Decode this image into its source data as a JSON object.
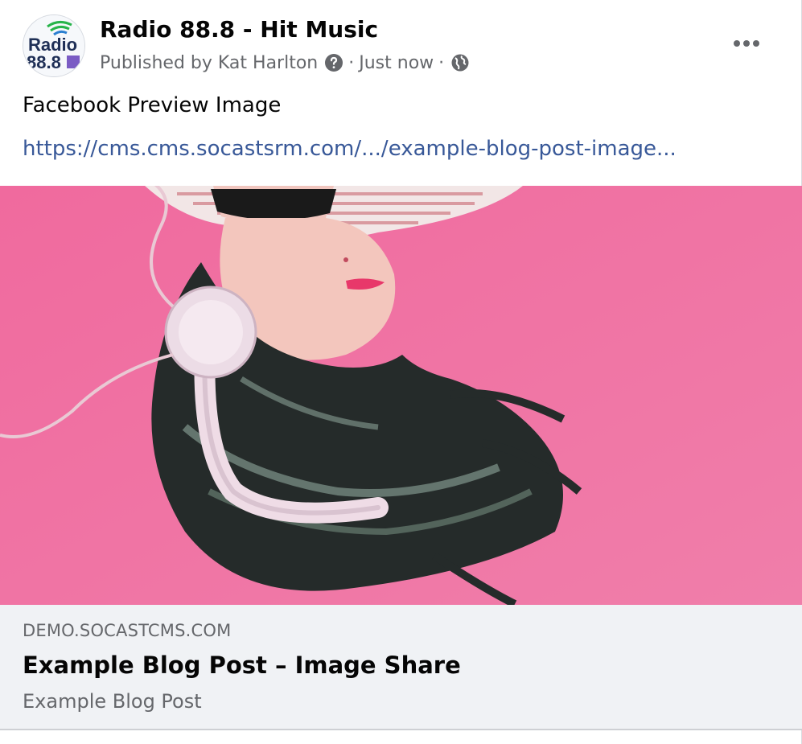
{
  "post": {
    "page_name": "Radio 88.8 - Hit Music",
    "meta": {
      "published_by": "Published by Kat Harlton",
      "separator": "·",
      "time": "Just now"
    },
    "avatar_logo": {
      "wordmark": "Radio",
      "frequency": "88.8"
    },
    "text": "Facebook Preview Image",
    "link": "https://cms.cms.socastsrm.com/.../example-blog-post-image..."
  },
  "link_card": {
    "domain": "DEMO.SOCASTCMS.COM",
    "title": "Example Blog Post – Image Share",
    "description": "Example Blog Post"
  },
  "icons": {
    "help": "question-circle-icon",
    "privacy": "globe-icon",
    "more": "more-horizontal-icon"
  },
  "colors": {
    "page_name": "#050505",
    "meta_gray": "#65676b",
    "link_blue": "#385898",
    "card_bg": "#f0f2f5",
    "image_pink": "#f07aa6"
  }
}
